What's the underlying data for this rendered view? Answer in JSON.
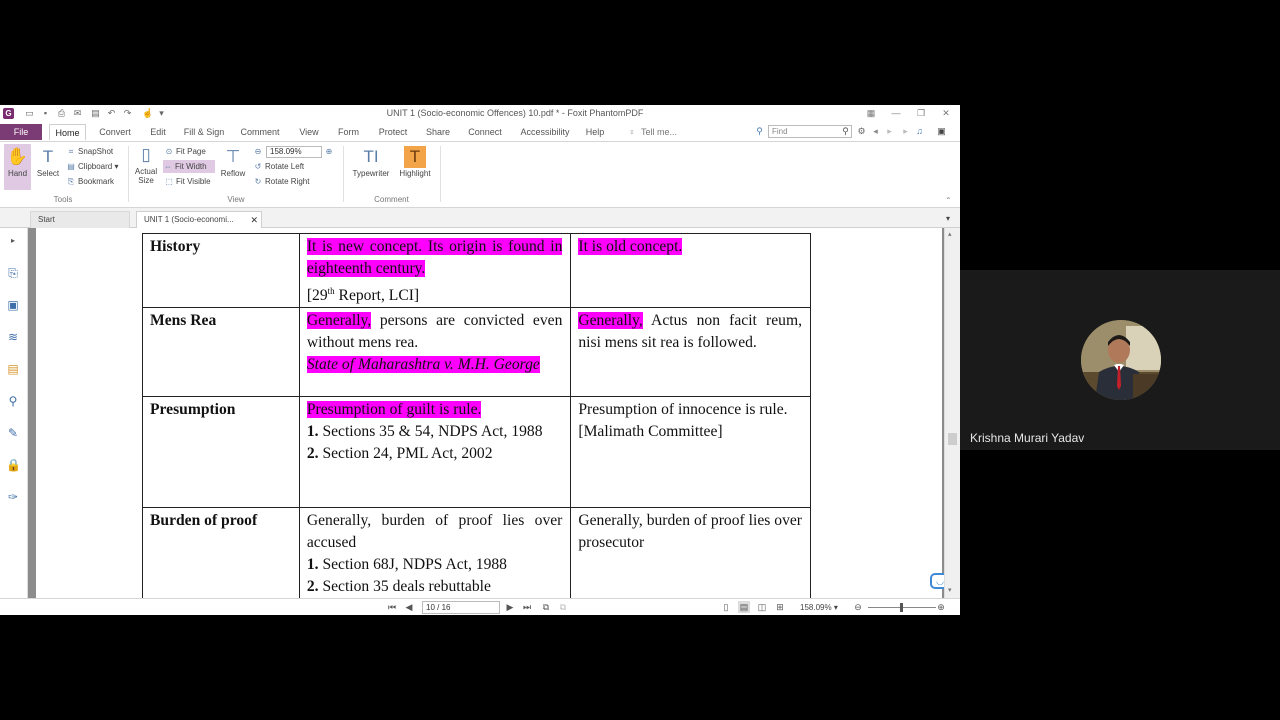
{
  "window": {
    "title": "UNIT 1 (Socio-economic Offences) 10.pdf * - Foxit PhantomPDF"
  },
  "menu": {
    "file": "File",
    "tabs": [
      "Home",
      "Convert",
      "Edit",
      "Fill & Sign",
      "Comment",
      "View",
      "Form",
      "Protect",
      "Share",
      "Connect",
      "Accessibility",
      "Help"
    ],
    "tell_me": "Tell me...",
    "find_placeholder": "Find"
  },
  "ribbon": {
    "hand": "Hand",
    "select": "Select",
    "snapshot": "SnapShot",
    "clipboard": "Clipboard",
    "bookmark": "Bookmark",
    "tools_group": "Tools",
    "actual_size_1": "Actual",
    "actual_size_2": "Size",
    "fit_page": "Fit Page",
    "fit_width": "Fit Width",
    "fit_visible": "Fit Visible",
    "reflow": "Reflow",
    "zoom_value": "158.09%",
    "rotate_left": "Rotate Left",
    "rotate_right": "Rotate Right",
    "view_group": "View",
    "typewriter": "Typewriter",
    "highlight": "Highlight",
    "comment_group": "Comment"
  },
  "doc_tabs": {
    "start": "Start",
    "current": "UNIT 1 (Socio-economi..."
  },
  "table": {
    "history": {
      "label": "History",
      "col2_hl": "It is new concept. Its origin is found in eighteenth century.",
      "col2_ref_pre": "[29",
      "col2_ref_sup": "th",
      "col2_ref_post": " Report, LCI]",
      "col3_hl": "It is old concept."
    },
    "mens_rea": {
      "label": "Mens Rea",
      "col2_hl": "Generally,",
      "col2_text": " persons are convicted even without mens rea.",
      "col2_case": "State of Maharashtra v. M.H. George",
      "col3_hl": "Generally,",
      "col3_text": " Actus non facit reum, nisi mens sit rea is followed."
    },
    "presumption": {
      "label": "Presumption",
      "col2_hl": "Presumption of guilt is rule.",
      "col2_n1": "1.",
      "col2_i1": " Sections 35 & 54, NDPS Act, 1988",
      "col2_n2": "2.",
      "col2_i2": " Section 24, PML Act, 2002",
      "col3_text": "Presumption of innocence is rule.",
      "col3_ref": "[Malimath Committee]"
    },
    "burden": {
      "label": "Burden of proof",
      "col2_text": "Generally, burden of proof lies over accused",
      "col2_n1": "1.",
      "col2_i1": " Section 68J, NDPS Act, 1988",
      "col2_n2": "2.",
      "col2_i2": " Section 35 deals rebuttable",
      "col3_text": "Generally, burden of proof lies over prosecutor"
    }
  },
  "status": {
    "page": "10 / 16",
    "zoom": "158.09%"
  },
  "participant": {
    "name": "Krishna Murari Yadav"
  }
}
